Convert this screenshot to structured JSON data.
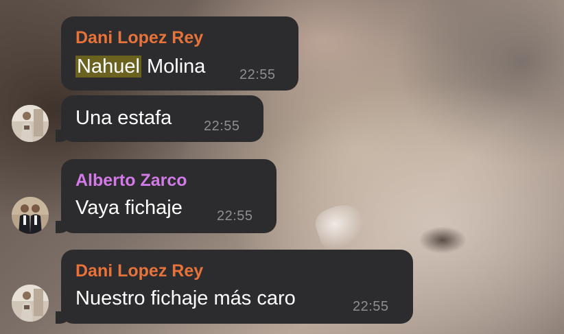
{
  "chat": {
    "messages": [
      {
        "sender": "Dani Lopez Rey",
        "sender_color": "#e8733a",
        "text_highlight": "Nahuel",
        "text_rest": " Molina",
        "time": "22:55"
      },
      {
        "text": "Una estafa",
        "time": "22:55",
        "avatar": "avatar-dani"
      },
      {
        "sender": "Alberto Zarco",
        "sender_color": "#d27be8",
        "text": "Vaya fichaje",
        "time": "22:55",
        "avatar": "avatar-alberto"
      },
      {
        "sender": "Dani Lopez Rey",
        "sender_color": "#e8733a",
        "text": "Nuestro fichaje más caro",
        "time": "22:55",
        "avatar": "avatar-dani"
      }
    ]
  },
  "colors": {
    "bubble": "#2c2c2e",
    "timestamp": "#8e8e93",
    "search_highlight": "#6b6220"
  }
}
